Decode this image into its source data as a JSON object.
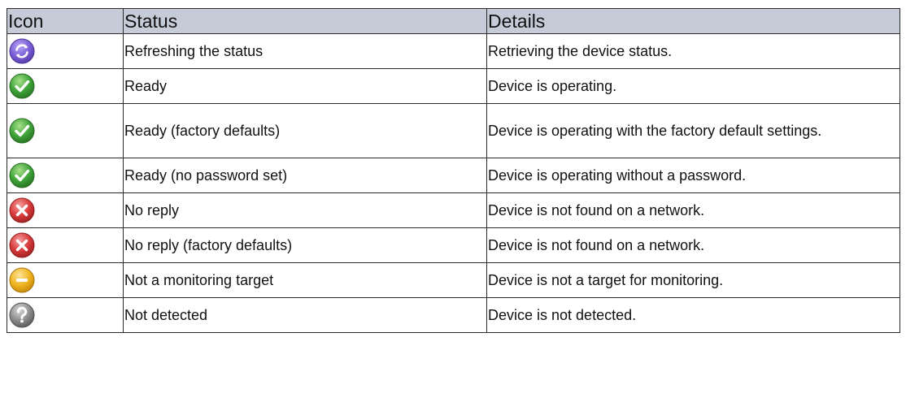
{
  "table": {
    "headers": {
      "icon": "Icon",
      "status": "Status",
      "details": "Details"
    },
    "rows": [
      {
        "icon": "refresh-icon",
        "status": "Refreshing the status",
        "details": "Retrieving the device status."
      },
      {
        "icon": "checkmark-icon",
        "status": "Ready",
        "details": "Device is operating."
      },
      {
        "icon": "checkmark-icon",
        "status": "Ready (factory defaults)",
        "details": "Device is operating with the factory default settings."
      },
      {
        "icon": "checkmark-icon",
        "status": "Ready (no password set)",
        "details": "Device is operating without a password."
      },
      {
        "icon": "error-x-icon",
        "status": "No reply",
        "details": "Device is not found on a network."
      },
      {
        "icon": "error-x-icon",
        "status": "No reply (factory defaults)",
        "details": "Device is not found on a network."
      },
      {
        "icon": "minus-icon",
        "status": "Not a monitoring target",
        "details": "Device is not a target for monitoring."
      },
      {
        "icon": "question-mark-icon",
        "status": "Not detected",
        "details": "Device is not detected."
      }
    ]
  },
  "colors": {
    "header_background": "#c6cbd8",
    "border": "#2a2a2a",
    "refresh": "#7a5fd6",
    "ready": "#3fa43a",
    "error": "#d83a3a",
    "not_target": "#f0b41f",
    "not_detected": "#8e8e8e"
  }
}
